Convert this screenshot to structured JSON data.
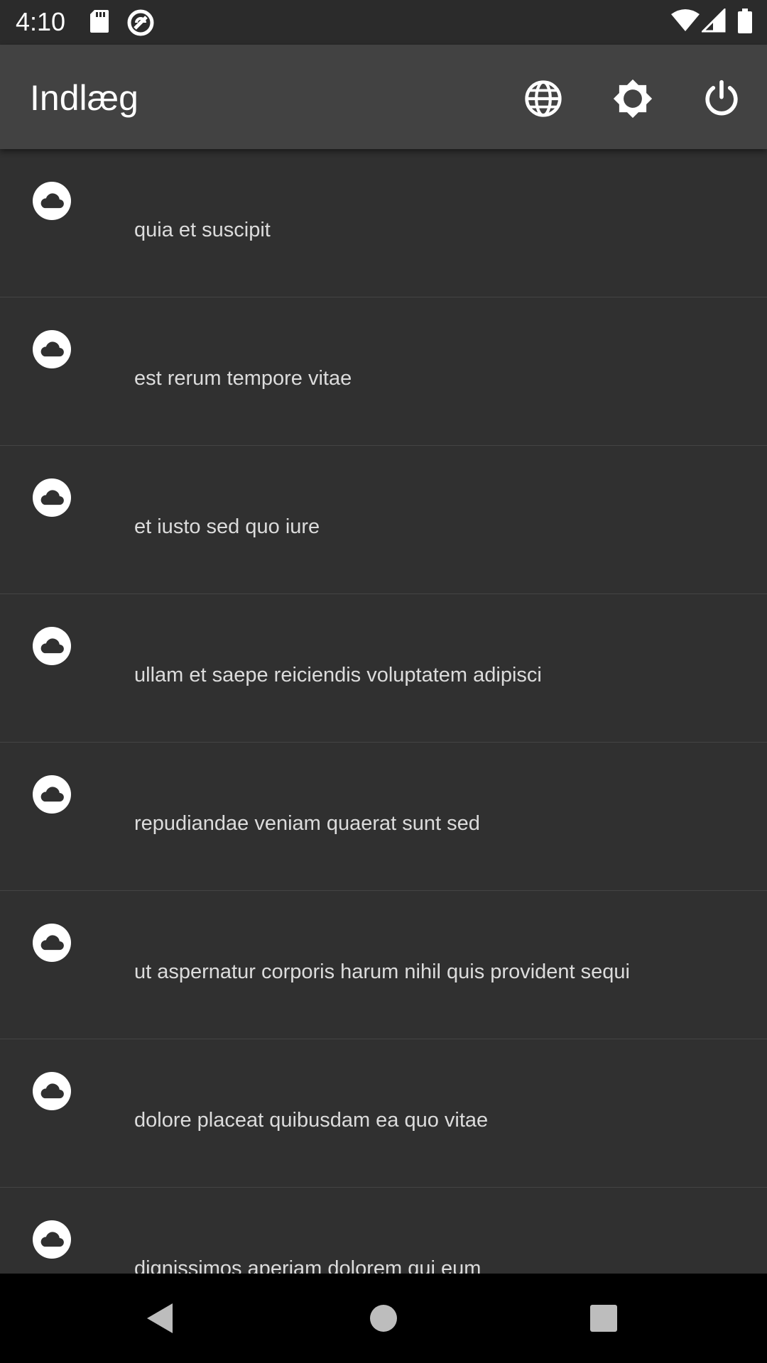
{
  "status_bar": {
    "time": "4:10",
    "icons": [
      "sd-card-icon",
      "no-tracking-icon",
      "wifi-icon",
      "signal-icon",
      "battery-icon"
    ]
  },
  "app_bar": {
    "title": "Indlæg",
    "actions": [
      "globe-icon",
      "brightness-icon",
      "power-icon"
    ]
  },
  "posts": [
    {
      "icon": "cloud-icon",
      "title": "quia et suscipit"
    },
    {
      "icon": "cloud-icon",
      "title": "est rerum tempore vitae"
    },
    {
      "icon": "cloud-icon",
      "title": "et iusto sed quo iure"
    },
    {
      "icon": "cloud-icon",
      "title": "ullam et saepe reiciendis voluptatem adipisci"
    },
    {
      "icon": "cloud-icon",
      "title": "repudiandae veniam quaerat sunt sed"
    },
    {
      "icon": "cloud-icon",
      "title": "ut aspernatur corporis harum nihil quis provident sequi"
    },
    {
      "icon": "cloud-icon",
      "title": "dolore placeat quibusdam ea quo vitae"
    },
    {
      "icon": "cloud-icon",
      "title": "dignissimos aperiam dolorem qui eum"
    }
  ],
  "nav_bar": {
    "buttons": [
      "back-icon",
      "home-icon",
      "recents-icon"
    ]
  },
  "colors": {
    "background": "#303030",
    "app_bar": "#424242",
    "status_bar": "#2b2b2b",
    "text": "#dcdcdc",
    "divider": "#444444"
  }
}
